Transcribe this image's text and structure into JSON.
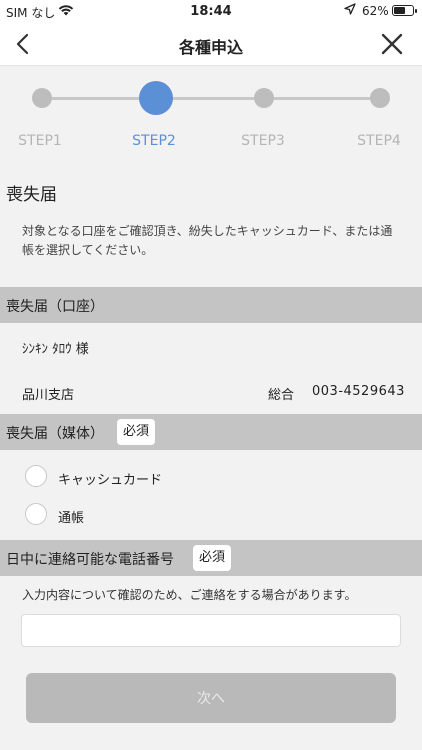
{
  "status_bar": {
    "carrier": "SIM なし",
    "time": "18:44",
    "battery": "62%",
    "battery_level": 0.62
  },
  "nav": {
    "title": "各種申込",
    "back_icon": "chevron-left-icon",
    "close_icon": "close-icon"
  },
  "stepper": {
    "steps": [
      "STEP1",
      "STEP2",
      "STEP3",
      "STEP4"
    ],
    "current_step": 2,
    "active_color": "#5b8fd6",
    "inactive_color": "#bdbdbd"
  },
  "page": {
    "title": "喪失届",
    "description": "対象となる口座をご確認頂き、紛失したキャッシュカード、または通帳を選択してください。"
  },
  "account_section": {
    "header": "喪失届（口座）",
    "name": "ｼﾝｷﾝ ﾀﾛｳ 様",
    "branch": "品川支店",
    "type": "総合",
    "number": "003-4529643"
  },
  "media_section": {
    "header": "喪失届（媒体）",
    "required": "必須",
    "options": [
      "キャッシュカード",
      "通帳"
    ]
  },
  "phone_section": {
    "header": "日中に連絡可能な電話番号",
    "required": "必須",
    "note": "入力内容について確認のため、ご連絡をする場合があります。",
    "value": "",
    "placeholder": ""
  },
  "next_button": "次へ"
}
